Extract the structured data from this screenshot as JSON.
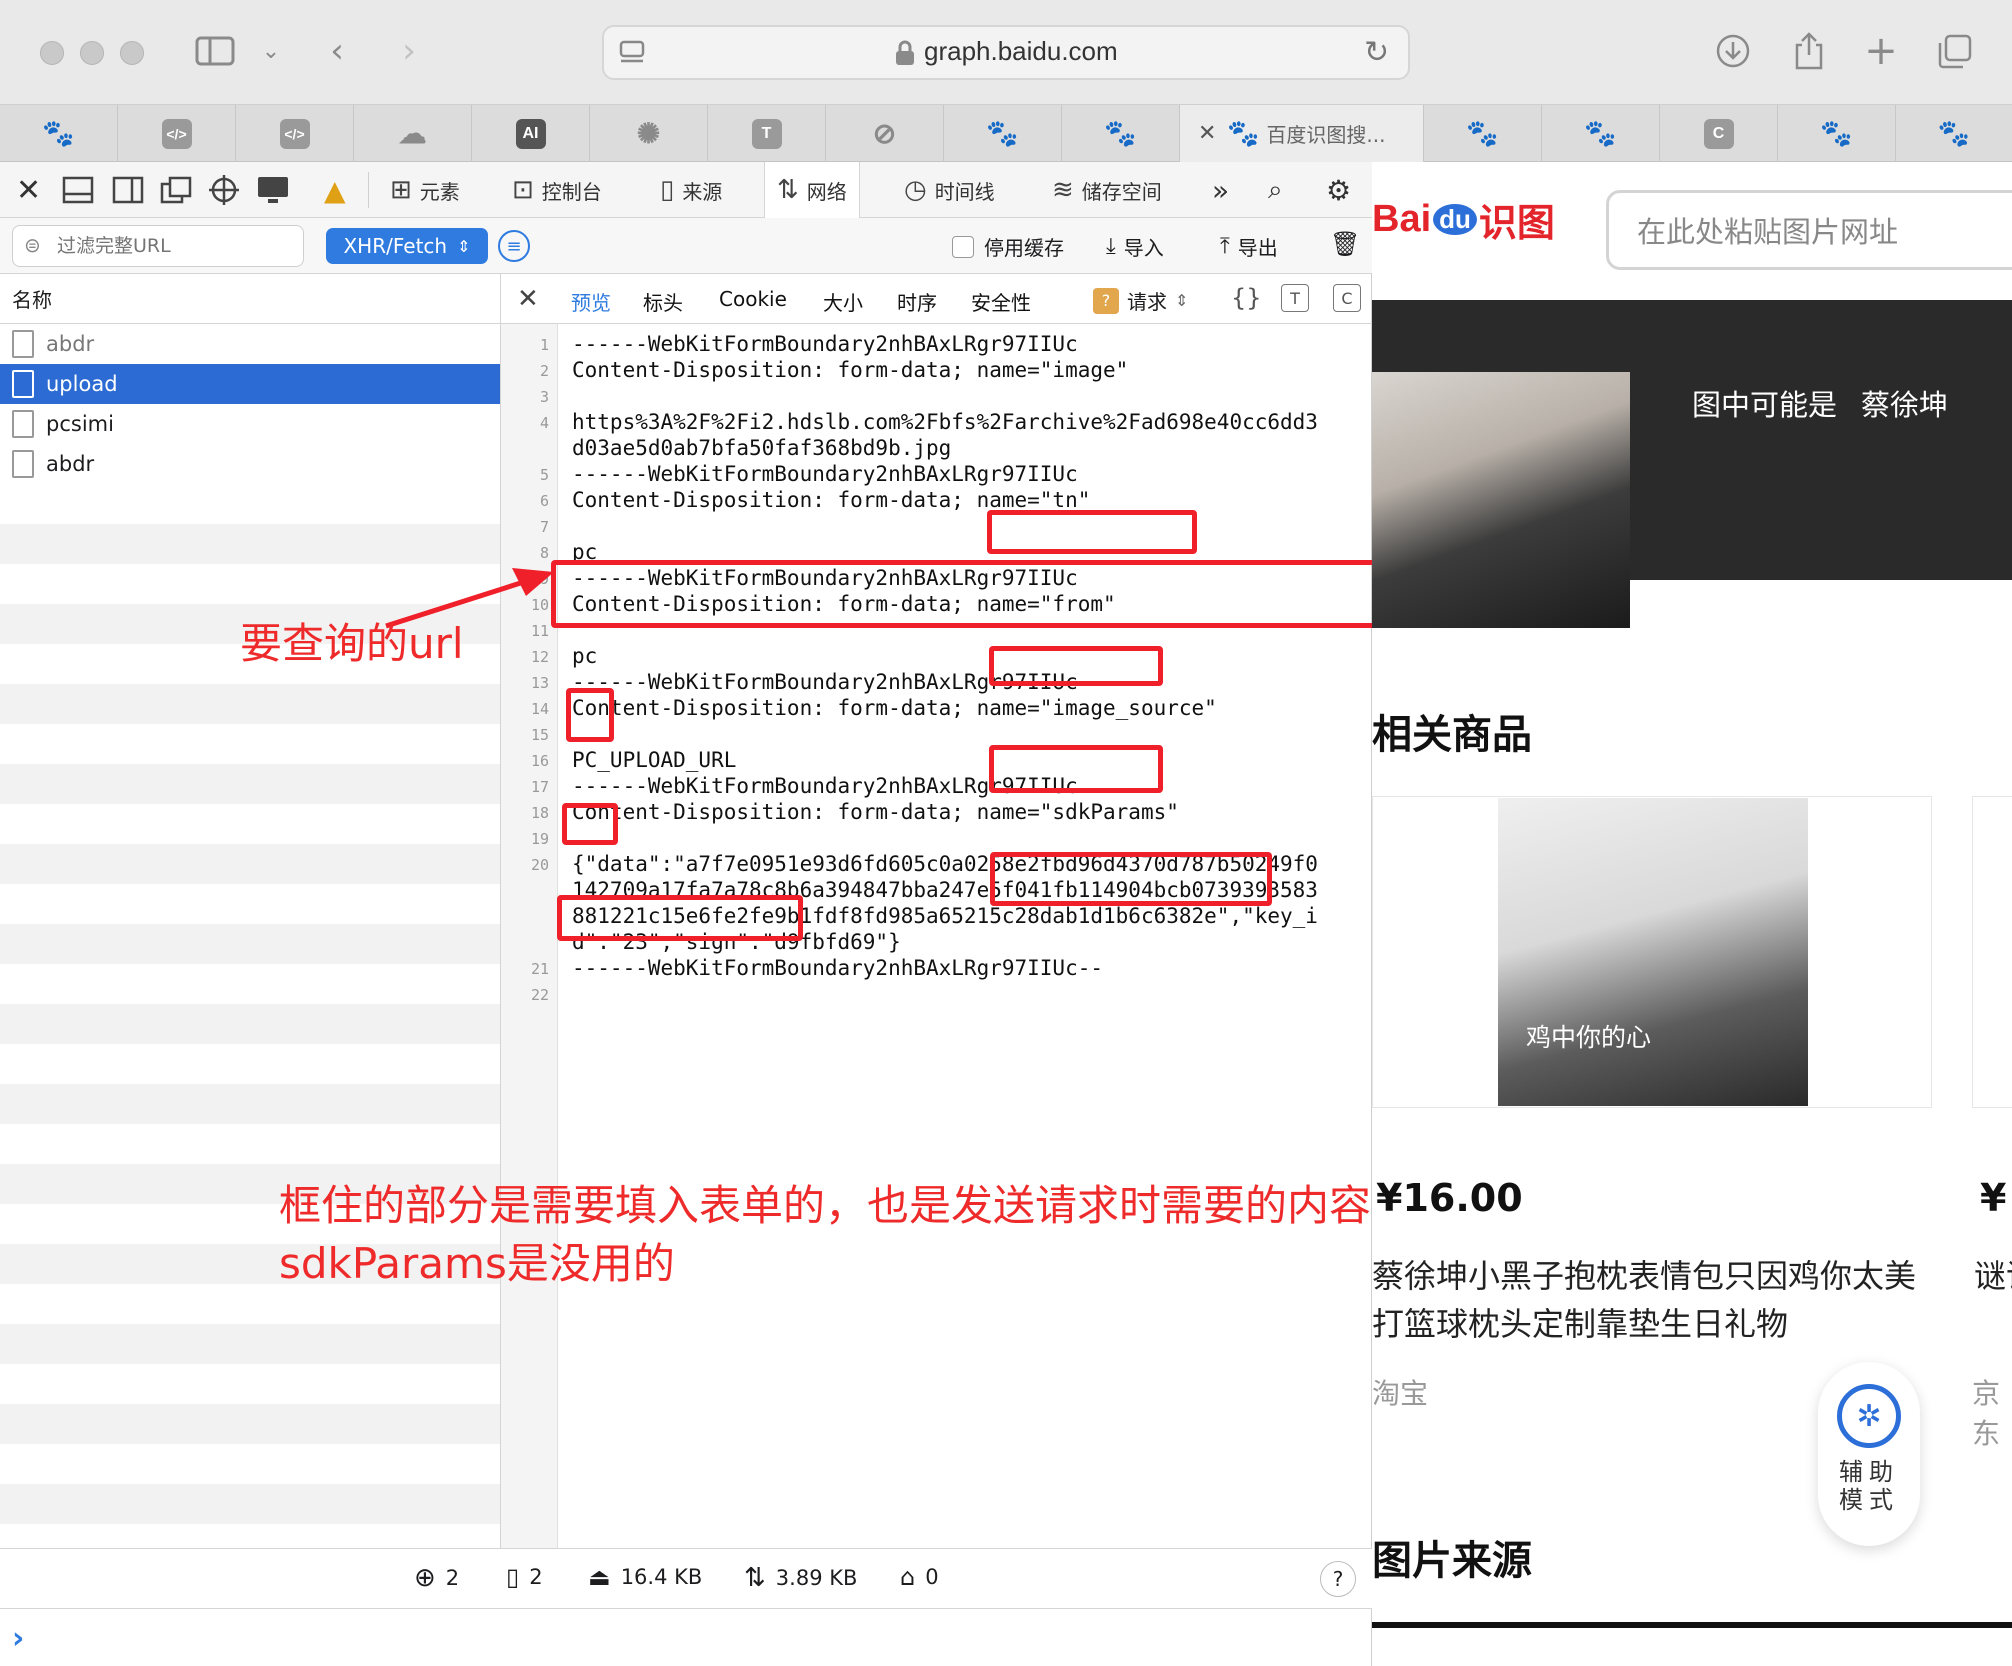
{
  "window": {
    "url": "graph.baidu.com"
  },
  "tabs": {
    "icons": [
      "baidu",
      "code",
      "code",
      "cloud",
      "AI",
      "openai",
      "T",
      "compass",
      "baidu",
      "baidu",
      "active",
      "baidu",
      "baidu",
      "C",
      "baidu",
      "baidu"
    ],
    "icon_letters": {
      "ai": "AI",
      "t": "T",
      "c": "C"
    },
    "active_title": "百度识图搜..."
  },
  "devtools": {
    "toolbar_tabs": [
      {
        "label": "元素",
        "icon": "elements-icon"
      },
      {
        "label": "控制台",
        "icon": "console-icon"
      },
      {
        "label": "来源",
        "icon": "sources-icon"
      },
      {
        "label": "网络",
        "icon": "network-icon"
      },
      {
        "label": "时间线",
        "icon": "timeline-icon"
      },
      {
        "label": "储存空间",
        "icon": "storage-icon"
      }
    ],
    "active_tab": "网络",
    "filter_placeholder": "过滤完整URL",
    "type_filter": "XHR/Fetch",
    "disable_cache": "停用缓存",
    "import": "导入",
    "export": "导出",
    "list_header": "名称",
    "requests": [
      "abdr",
      "upload",
      "pcsimi",
      "abdr"
    ],
    "selected_request": "upload",
    "detail_tabs": [
      "预览",
      "标头",
      "Cookie",
      "大小",
      "时序",
      "安全性"
    ],
    "active_detail_tab": "预览",
    "request_selector": "请求",
    "code_lines": [
      {
        "n": "1",
        "text": "------WebKitFormBoundary2nhBAxLRgr97IIUc"
      },
      {
        "n": "2",
        "text": "Content-Disposition: form-data; name=\"image\""
      },
      {
        "n": "3",
        "text": ""
      },
      {
        "n": "4",
        "text": "https%3A%2F%2Fi2.hdslb.com%2Fbfs%2Farchive%2Fad698e40cc6dd3"
      },
      {
        "n": "",
        "text": "d03ae5d0ab7bfa50faf368bd9b.jpg"
      },
      {
        "n": "5",
        "text": "------WebKitFormBoundary2nhBAxLRgr97IIUc"
      },
      {
        "n": "6",
        "text": "Content-Disposition: form-data; name=\"tn\""
      },
      {
        "n": "7",
        "text": ""
      },
      {
        "n": "8",
        "text": "pc"
      },
      {
        "n": "9",
        "text": "------WebKitFormBoundary2nhBAxLRgr97IIUc"
      },
      {
        "n": "10",
        "text": "Content-Disposition: form-data; name=\"from\""
      },
      {
        "n": "11",
        "text": ""
      },
      {
        "n": "12",
        "text": "pc"
      },
      {
        "n": "13",
        "text": "------WebKitFormBoundary2nhBAxLRgr97IIUc"
      },
      {
        "n": "14",
        "text": "Content-Disposition: form-data; name=\"image_source\""
      },
      {
        "n": "15",
        "text": ""
      },
      {
        "n": "16",
        "text": "PC_UPLOAD_URL"
      },
      {
        "n": "17",
        "text": "------WebKitFormBoundary2nhBAxLRgr97IIUc"
      },
      {
        "n": "18",
        "text": "Content-Disposition: form-data; name=\"sdkParams\""
      },
      {
        "n": "19",
        "text": ""
      },
      {
        "n": "20",
        "text": "{\"data\":\"a7f7e0951e93d6fd605c0a0258e2fbd96d4370d787b50249f0"
      },
      {
        "n": "",
        "text": "142709a17fa7a78c8b6a394847bba247e5f041fb114904bcb0739393583"
      },
      {
        "n": "",
        "text": "881221c15e6fe2fe9b1fdf8fd985a65215c28dab1d1b6c6382e\",\"key_i"
      },
      {
        "n": "",
        "text": "d\":\"23\",\"sign\":\"d9fbfd69\"}"
      },
      {
        "n": "21",
        "text": "------WebKitFormBoundary2nhBAxLRgr97IIUc--"
      },
      {
        "n": "22",
        "text": ""
      }
    ],
    "status": {
      "requests": "2",
      "resources": "2",
      "transferred": "16.4 KB",
      "size": "3.89 KB",
      "errors": "0",
      "help": "?"
    },
    "console_prompt": "›"
  },
  "annotations": {
    "url_note": "要查询的url",
    "form_note_line1": "框住的部分是需要填入表单的，也是发送请求时需要的内容",
    "form_note_line2": "sdkParams是没用的"
  },
  "baidu": {
    "logo": "Bai",
    "logo_du": "du",
    "logo_suffix": "识图",
    "input_placeholder": "在此处粘贴图片网址",
    "maybe_label": "图中可能是",
    "maybe_name": "蔡徐坤",
    "related_title": "相关商品",
    "card_caption": "鸡中你的心",
    "price": "¥16.00",
    "price_partial": "¥",
    "product_title": "蔡徐坤小黑子抱枕表情包只因鸡你太美打篮球枕头定制靠垫生日礼物",
    "product_title_partial": "谜语 包",
    "shop": "淘宝",
    "shop_partial": "京东",
    "assist_label": "辅助模式",
    "source_title": "图片来源"
  },
  "colors": {
    "accent": "#2f7be0",
    "selection": "#2b6bd3",
    "annotation_red": "#f0202a",
    "baidu_red": "#e3242b",
    "baidu_blue": "#2d6fd8"
  }
}
